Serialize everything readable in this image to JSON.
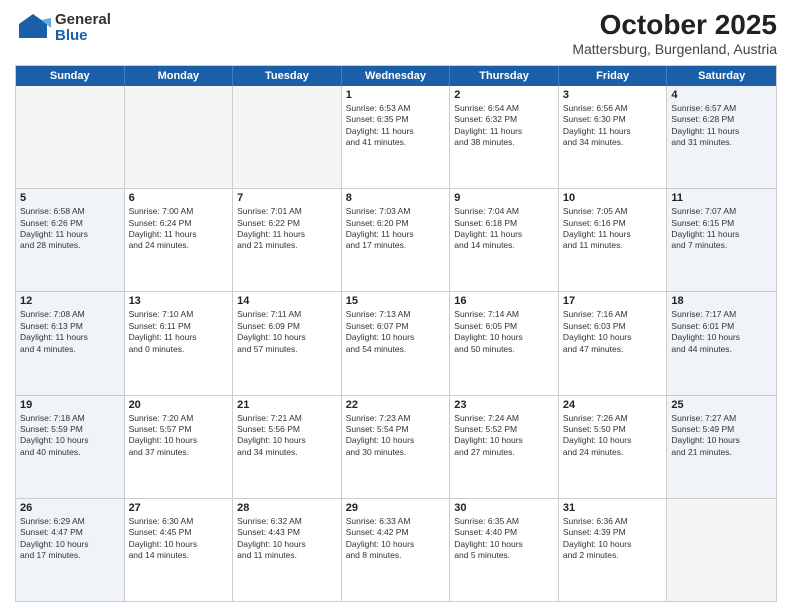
{
  "logo": {
    "general": "General",
    "blue": "Blue"
  },
  "title": "October 2025",
  "subtitle": "Mattersburg, Burgenland, Austria",
  "weekdays": [
    "Sunday",
    "Monday",
    "Tuesday",
    "Wednesday",
    "Thursday",
    "Friday",
    "Saturday"
  ],
  "rows": [
    [
      {
        "day": "",
        "info": "",
        "empty": true
      },
      {
        "day": "",
        "info": "",
        "empty": true
      },
      {
        "day": "",
        "info": "",
        "empty": true
      },
      {
        "day": "1",
        "info": "Sunrise: 6:53 AM\nSunset: 6:35 PM\nDaylight: 11 hours\nand 41 minutes."
      },
      {
        "day": "2",
        "info": "Sunrise: 6:54 AM\nSunset: 6:32 PM\nDaylight: 11 hours\nand 38 minutes."
      },
      {
        "day": "3",
        "info": "Sunrise: 6:56 AM\nSunset: 6:30 PM\nDaylight: 11 hours\nand 34 minutes."
      },
      {
        "day": "4",
        "info": "Sunrise: 6:57 AM\nSunset: 6:28 PM\nDaylight: 11 hours\nand 31 minutes.",
        "shaded": true
      }
    ],
    [
      {
        "day": "5",
        "info": "Sunrise: 6:58 AM\nSunset: 6:26 PM\nDaylight: 11 hours\nand 28 minutes.",
        "shaded": true
      },
      {
        "day": "6",
        "info": "Sunrise: 7:00 AM\nSunset: 6:24 PM\nDaylight: 11 hours\nand 24 minutes."
      },
      {
        "day": "7",
        "info": "Sunrise: 7:01 AM\nSunset: 6:22 PM\nDaylight: 11 hours\nand 21 minutes."
      },
      {
        "day": "8",
        "info": "Sunrise: 7:03 AM\nSunset: 6:20 PM\nDaylight: 11 hours\nand 17 minutes."
      },
      {
        "day": "9",
        "info": "Sunrise: 7:04 AM\nSunset: 6:18 PM\nDaylight: 11 hours\nand 14 minutes."
      },
      {
        "day": "10",
        "info": "Sunrise: 7:05 AM\nSunset: 6:16 PM\nDaylight: 11 hours\nand 11 minutes."
      },
      {
        "day": "11",
        "info": "Sunrise: 7:07 AM\nSunset: 6:15 PM\nDaylight: 11 hours\nand 7 minutes.",
        "shaded": true
      }
    ],
    [
      {
        "day": "12",
        "info": "Sunrise: 7:08 AM\nSunset: 6:13 PM\nDaylight: 11 hours\nand 4 minutes.",
        "shaded": true
      },
      {
        "day": "13",
        "info": "Sunrise: 7:10 AM\nSunset: 6:11 PM\nDaylight: 11 hours\nand 0 minutes."
      },
      {
        "day": "14",
        "info": "Sunrise: 7:11 AM\nSunset: 6:09 PM\nDaylight: 10 hours\nand 57 minutes."
      },
      {
        "day": "15",
        "info": "Sunrise: 7:13 AM\nSunset: 6:07 PM\nDaylight: 10 hours\nand 54 minutes."
      },
      {
        "day": "16",
        "info": "Sunrise: 7:14 AM\nSunset: 6:05 PM\nDaylight: 10 hours\nand 50 minutes."
      },
      {
        "day": "17",
        "info": "Sunrise: 7:16 AM\nSunset: 6:03 PM\nDaylight: 10 hours\nand 47 minutes."
      },
      {
        "day": "18",
        "info": "Sunrise: 7:17 AM\nSunset: 6:01 PM\nDaylight: 10 hours\nand 44 minutes.",
        "shaded": true
      }
    ],
    [
      {
        "day": "19",
        "info": "Sunrise: 7:18 AM\nSunset: 5:59 PM\nDaylight: 10 hours\nand 40 minutes.",
        "shaded": true
      },
      {
        "day": "20",
        "info": "Sunrise: 7:20 AM\nSunset: 5:57 PM\nDaylight: 10 hours\nand 37 minutes."
      },
      {
        "day": "21",
        "info": "Sunrise: 7:21 AM\nSunset: 5:56 PM\nDaylight: 10 hours\nand 34 minutes."
      },
      {
        "day": "22",
        "info": "Sunrise: 7:23 AM\nSunset: 5:54 PM\nDaylight: 10 hours\nand 30 minutes."
      },
      {
        "day": "23",
        "info": "Sunrise: 7:24 AM\nSunset: 5:52 PM\nDaylight: 10 hours\nand 27 minutes."
      },
      {
        "day": "24",
        "info": "Sunrise: 7:26 AM\nSunset: 5:50 PM\nDaylight: 10 hours\nand 24 minutes."
      },
      {
        "day": "25",
        "info": "Sunrise: 7:27 AM\nSunset: 5:49 PM\nDaylight: 10 hours\nand 21 minutes.",
        "shaded": true
      }
    ],
    [
      {
        "day": "26",
        "info": "Sunrise: 6:29 AM\nSunset: 4:47 PM\nDaylight: 10 hours\nand 17 minutes.",
        "shaded": true
      },
      {
        "day": "27",
        "info": "Sunrise: 6:30 AM\nSunset: 4:45 PM\nDaylight: 10 hours\nand 14 minutes."
      },
      {
        "day": "28",
        "info": "Sunrise: 6:32 AM\nSunset: 4:43 PM\nDaylight: 10 hours\nand 11 minutes."
      },
      {
        "day": "29",
        "info": "Sunrise: 6:33 AM\nSunset: 4:42 PM\nDaylight: 10 hours\nand 8 minutes."
      },
      {
        "day": "30",
        "info": "Sunrise: 6:35 AM\nSunset: 4:40 PM\nDaylight: 10 hours\nand 5 minutes."
      },
      {
        "day": "31",
        "info": "Sunrise: 6:36 AM\nSunset: 4:39 PM\nDaylight: 10 hours\nand 2 minutes."
      },
      {
        "day": "",
        "info": "",
        "empty": true
      }
    ]
  ]
}
